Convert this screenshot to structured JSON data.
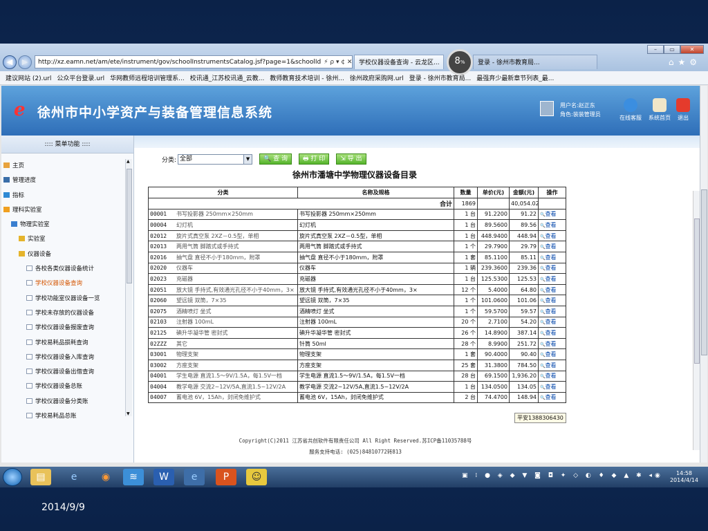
{
  "browser": {
    "url": "http://xz.eamn.net/am/ete/instrument/gov/schoolInstrumentsCatalog.jsf?page=1&schoolId",
    "url_controls": "⚡ ρ ▾ ¢ ✕",
    "tab_active": "学校仪器设备查询 - 云龙区...",
    "tab_other": "登录 - 徐州市教育局...",
    "badge_value": "8",
    "badge_unit": "%",
    "favorites": [
      "建议网站 (2).url",
      "公众平台登录.url",
      "华网教师远程培训管理系...",
      "校讯通_江苏校讯通_云教...",
      "教师教育技术培训 - 徐州...",
      "徐州政府采购网.url",
      "登录 - 徐州市教育局...",
      "最强弃少最新章节列表_最..."
    ]
  },
  "header": {
    "logo": "e",
    "title": "徐州市中小学资产与装备管理信息系统",
    "user_name": "用户名:赵正东",
    "user_role": "角色:装装管理员",
    "buttons": [
      "在线客服",
      "系统首页",
      "退出"
    ]
  },
  "sidebar": {
    "title": "::::  菜单功能  ::::",
    "items": [
      {
        "label": "主页",
        "level": 0
      },
      {
        "label": "管理进度",
        "level": 0
      },
      {
        "label": "指标",
        "level": 0
      },
      {
        "label": "理科实验室",
        "level": 0
      },
      {
        "label": "物理实验室",
        "level": 1
      },
      {
        "label": "实验室",
        "level": 2
      },
      {
        "label": "仪器设备",
        "level": 2
      },
      {
        "label": "各校各类仪器设备统计",
        "level": 3
      },
      {
        "label": "学校仪器设备查询",
        "level": 3
      },
      {
        "label": "学校功能室仪器设备一览",
        "level": 3
      },
      {
        "label": "学校未存放的仪器设备",
        "level": 3
      },
      {
        "label": "学校仪器设备报废查询",
        "level": 3
      },
      {
        "label": "学校易耗品损耗查询",
        "level": 3
      },
      {
        "label": "学校仪器设备入库查询",
        "level": 3
      },
      {
        "label": "学校仪器设备出借查询",
        "level": 3
      },
      {
        "label": "学校仪器设备总账",
        "level": 3
      },
      {
        "label": "学校仪器设备分类账",
        "level": 3
      },
      {
        "label": "学校易耗品总账",
        "level": 3
      }
    ]
  },
  "toolbar": {
    "category_label": "分类:",
    "category_value": "全部",
    "query_label": "查 询",
    "print_label": "打 印",
    "export_label": "导 出"
  },
  "table": {
    "title": "徐州市潘塘中学物理仪器设备目录",
    "headers": [
      "分类",
      "名称及规格",
      "数量",
      "单价(元)",
      "金额(元)",
      "操作"
    ],
    "total_label": "合计",
    "total_qty": "1869",
    "total_amount": "40,054.02",
    "action_label": "查看",
    "rows": [
      {
        "code": "00001",
        "cat": "书写投影器 250mm×250mm",
        "name": "书写投影器 250mm×250mm",
        "qty": "1 台",
        "price": "91.2200",
        "amount": "91.22"
      },
      {
        "code": "00004",
        "cat": "幻灯机",
        "name": "幻灯机",
        "qty": "1 台",
        "price": "89.5600",
        "amount": "89.56"
      },
      {
        "code": "02012",
        "cat": "旋片式真空泵 2XZ－0.5型，单相",
        "name": "旋片式真空泵 2XZ－0.5型，单相",
        "qty": "1 台",
        "price": "448.9400",
        "amount": "448.94"
      },
      {
        "code": "02013",
        "cat": "两用气筒 脚踏式或手持式",
        "name": "两用气筒 脚踏式或手持式",
        "qty": "1 个",
        "price": "29.7900",
        "amount": "29.79"
      },
      {
        "code": "02016",
        "cat": "抽气盘 直径不小于180mm，附罩",
        "name": "抽气盘 直径不小于180mm，附罩",
        "qty": "1 套",
        "price": "85.1100",
        "amount": "85.11"
      },
      {
        "code": "02020",
        "cat": "仪器车",
        "name": "仪器车",
        "qty": "1 辆",
        "price": "239.3600",
        "amount": "239.36"
      },
      {
        "code": "02023",
        "cat": "充磁器",
        "name": "充磁器",
        "qty": "1 台",
        "price": "125.5300",
        "amount": "125.53"
      },
      {
        "code": "02051",
        "cat": "放大镜 手持式,有效通光孔径不小于40mm，3×",
        "name": "放大镜 手持式,有效通光孔径不小于40mm，3×",
        "qty": "12 个",
        "price": "5.4000",
        "amount": "64.80"
      },
      {
        "code": "02060",
        "cat": "望远镜 双筒，7×35",
        "name": "望远镜 双筒，7×35",
        "qty": "1 个",
        "price": "101.0600",
        "amount": "101.06"
      },
      {
        "code": "02075",
        "cat": "酒精喷灯 坐式",
        "name": "酒精喷灯 坐式",
        "qty": "1 个",
        "price": "59.5700",
        "amount": "59.57"
      },
      {
        "code": "02103",
        "cat": "注射器 100mL",
        "name": "注射器 100mL",
        "qty": "20 个",
        "price": "2.7100",
        "amount": "54.20"
      },
      {
        "code": "02125",
        "cat": "碘升华凝华管 密封式",
        "name": "碘升华凝华管 密封式",
        "qty": "26 个",
        "price": "14.8900",
        "amount": "387.14"
      },
      {
        "code": "02ZZZ",
        "cat": "其它",
        "name": "针筒 50ml",
        "qty": "28 个",
        "price": "8.9900",
        "amount": "251.72"
      },
      {
        "code": "03001",
        "cat": "物理支架",
        "name": "物理支架",
        "qty": "1 套",
        "price": "90.4000",
        "amount": "90.40"
      },
      {
        "code": "03002",
        "cat": "方座支架",
        "name": "方座支架",
        "qty": "25 套",
        "price": "31.3800",
        "amount": "784.50"
      },
      {
        "code": "04001",
        "cat": "学生电源 直流1.5～9V/1.5A，每1.5V一档",
        "name": "学生电源 直流1.5～9V/1.5A，每1.5V一档",
        "qty": "28 台",
        "price": "69.1500",
        "amount": "1,936.20"
      },
      {
        "code": "04004",
        "cat": "教学电源 交流2~12V/5A,直流1.5~12V/2A",
        "name": "教学电源 交流2~12V/5A,直流1.5~12V/2A",
        "qty": "1 台",
        "price": "134.0500",
        "amount": "134.05"
      },
      {
        "code": "04007",
        "cat": "蓄电池 6V，15Ah，封闭免维护式",
        "name": "蓄电池 6V，15Ah，封闭免维护式",
        "qty": "2 台",
        "price": "74.4700",
        "amount": "148.94"
      }
    ]
  },
  "footer": {
    "line1": "Copyright(C)2011 江苏省共创软件有限责任公司 All Right Reserved.苏ICP备11035788号",
    "line2": "服务支持电话: (025)84810772转813"
  },
  "tooltip": "平安1388306430",
  "taskbar": {
    "time": "14:58",
    "date": "2014/4/14"
  },
  "slide_date": "2014/9/9"
}
